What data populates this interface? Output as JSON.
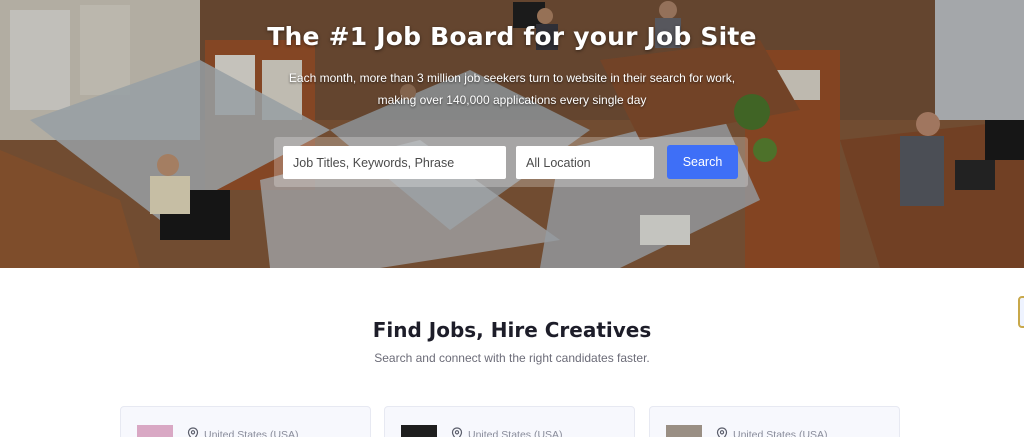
{
  "hero": {
    "title": "The #1 Job Board for your Job Site",
    "subtitle": "Each month, more than 3 million job seekers turn to website in their search for work, making over 140,000 applications every single day"
  },
  "search": {
    "keywords_placeholder": "Job Titles, Keywords, Phrase",
    "location_placeholder": "All Location",
    "button_label": "Search",
    "button_color": "#3e6ff7"
  },
  "section": {
    "title": "Find Jobs, Hire Creatives",
    "subtitle": "Search and connect with the right candidates faster."
  },
  "cards": [
    {
      "location": "United States (USA)",
      "icon": "map-pin-icon"
    },
    {
      "location": "United States (USA)",
      "icon": "map-pin-icon"
    },
    {
      "location": "United States (USA)",
      "icon": "map-pin-icon"
    }
  ]
}
